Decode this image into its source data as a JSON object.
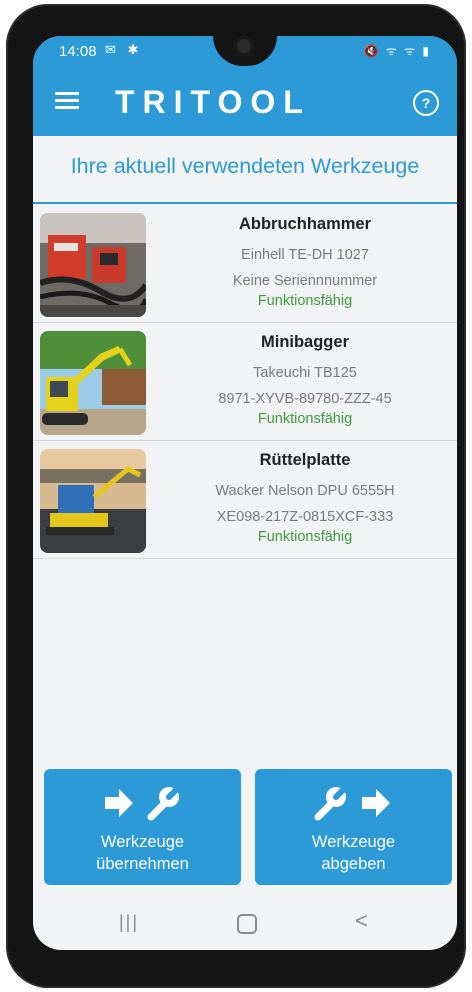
{
  "status_bar": {
    "time": "14:08",
    "left_icons": "✉ ✱",
    "right_icons": "🔇 ᯤ ᯤ ▮"
  },
  "app_bar": {
    "logo": "TRITOOL",
    "menu_icon": "hamburger-menu-icon",
    "help_icon": "question-circle-icon",
    "help_glyph": "?"
  },
  "section_title": "Ihre aktuell verwendeten Werkzeuge",
  "tools": [
    {
      "name": "Abbruchhammer",
      "model": "Einhell TE-DH 1027",
      "serial": "Keine Seriennnummer",
      "status": "Funktionsfähig"
    },
    {
      "name": "Minibagger",
      "model": "Takeuchi TB125",
      "serial": "8971-XYVB-89780-ZZZ-45",
      "status": "Funktionsfähig"
    },
    {
      "name": "Rüttelplatte",
      "model": "Wacker Nelson DPU 6555H",
      "serial": "XE098-217Z-0815XCF-333",
      "status": "Funktionsfähig"
    }
  ],
  "actions": {
    "take": {
      "line1": "Werkzeuge",
      "line2": "übernehmen"
    },
    "give": {
      "line1": "Werkzeuge",
      "line2": "abgeben"
    }
  },
  "nav": {
    "recent_glyph": "|||",
    "back_glyph": "<"
  },
  "colors": {
    "accent": "#2b9ad6",
    "status_ok": "#3f9a3b"
  }
}
